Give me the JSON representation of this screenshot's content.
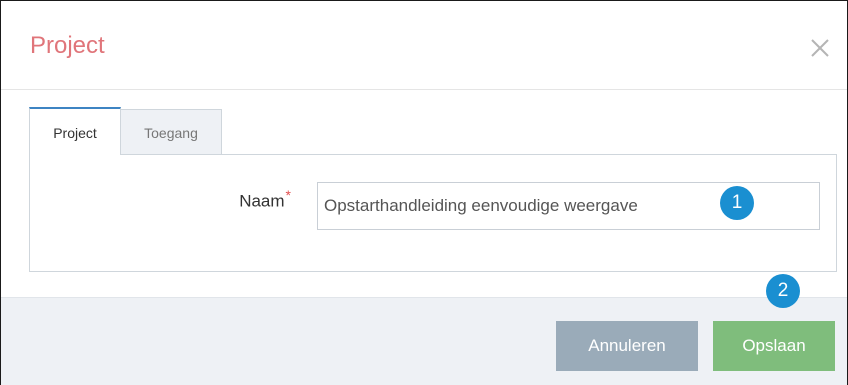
{
  "dialog": {
    "title": "Project",
    "close_icon": "close-icon"
  },
  "tabs": [
    {
      "label": "Project",
      "active": true
    },
    {
      "label": "Toegang",
      "active": false
    }
  ],
  "form": {
    "name_label": "Naam",
    "required_marker": "*",
    "name_value": "Opstarthandleiding eenvoudige weergave"
  },
  "callouts": [
    {
      "number": "1"
    },
    {
      "number": "2"
    }
  ],
  "footer": {
    "cancel_label": "Annuleren",
    "save_label": "Opslaan"
  },
  "colors": {
    "title": "#e0757a",
    "active_tab_accent": "#3d84c3",
    "cancel_button": "#9aabb9",
    "save_button": "#7fbd7c",
    "callout_badge": "#1a8fd1",
    "required_marker": "#e04e4e"
  }
}
